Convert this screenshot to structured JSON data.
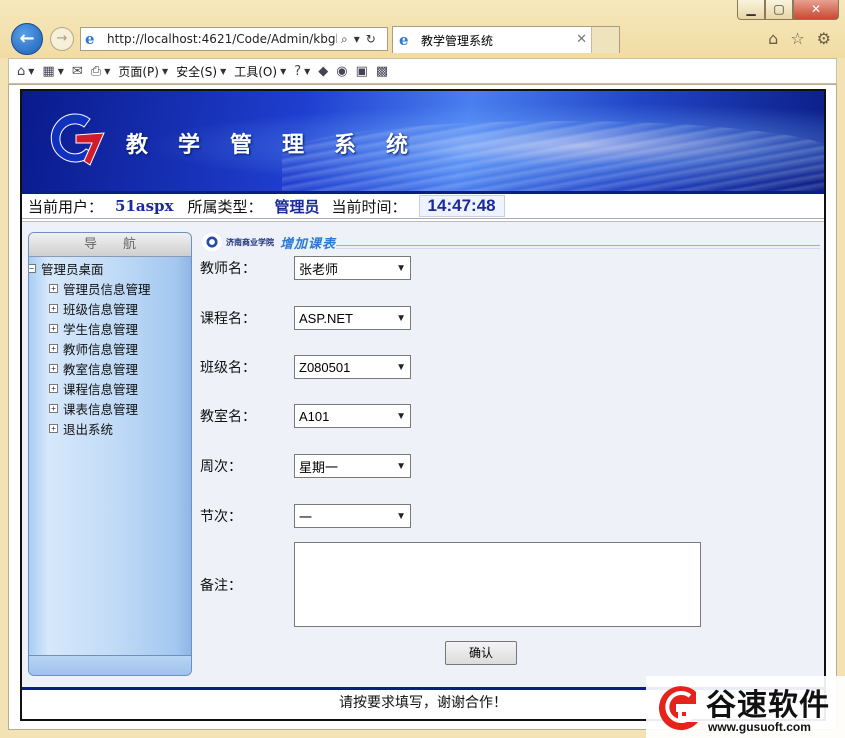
{
  "browser": {
    "address": "http://localhost:4621/Code/Admin/kbgl",
    "tab_title": "教学管理系统",
    "command_bar": {
      "page_menu": "页面(P)",
      "safety_menu": "安全(S)",
      "tools_menu": "工具(O)"
    }
  },
  "banner": {
    "title": "教学管理系统"
  },
  "status": {
    "user_label": "当前用户：",
    "user_value": "51aspx",
    "role_label": "所属类型：",
    "role_value": "管理员",
    "time_label": "当前时间：",
    "time_value": "14:47:48"
  },
  "sidebar": {
    "header": "导航",
    "root": "管理员桌面",
    "items": [
      {
        "label": "管理员信息管理"
      },
      {
        "label": "班级信息管理"
      },
      {
        "label": "学生信息管理"
      },
      {
        "label": "教师信息管理"
      },
      {
        "label": "教室信息管理"
      },
      {
        "label": "课程信息管理"
      },
      {
        "label": "课表信息管理"
      },
      {
        "label": "退出系统"
      }
    ]
  },
  "form": {
    "school_name": "济南商业学院",
    "title": "增加课表",
    "teacher": {
      "label": "教师名：",
      "value": "张老师"
    },
    "course": {
      "label": "课程名：",
      "value": "ASP.NET"
    },
    "class": {
      "label": "班级名：",
      "value": "Z080501"
    },
    "classroom": {
      "label": "教室名：",
      "value": "A101"
    },
    "weekday": {
      "label": "周次：",
      "value": "星期一"
    },
    "section": {
      "label": "节次：",
      "value": "一"
    },
    "remark": {
      "label": "备注："
    },
    "confirm_label": "确认"
  },
  "footer": {
    "text": "请按要求填写，谢谢合作！"
  },
  "watermark": {
    "brand": "谷速软件",
    "url": "www.gusuoft.com"
  },
  "colors": {
    "banner_dark": "#0b1d86",
    "accent_blue": "#1a2a9a",
    "form_title": "#2a7bd8"
  }
}
